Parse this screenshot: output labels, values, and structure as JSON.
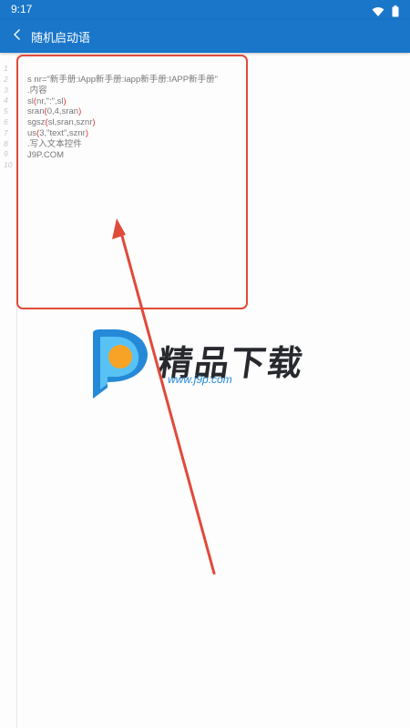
{
  "status_bar": {
    "time": "9:17",
    "icons": [
      "wifi-icon",
      "battery-icon"
    ]
  },
  "app_bar": {
    "title": "随机启动语",
    "back_icon": "chevron-left-icon"
  },
  "editor": {
    "line_numbers": [
      "1",
      "2",
      "3",
      "4",
      "5",
      "6",
      "7",
      "8",
      "9",
      "10"
    ],
    "lines": [
      "s nr=\"新手册:iApp新手册:iapp新手册:IAPP新手册\"",
      ".内容",
      "sl(nr,\":\",sl)",
      "sran(0,4,sran)",
      "sgsz(sl,sran,sznr)",
      "us(3,\"text\",sznr)",
      ".写入文本控件",
      "J9P.COM"
    ]
  },
  "watermark": {
    "brand": "精品下载",
    "url": "www.j9p.com"
  },
  "colors": {
    "primary": "#1976c9",
    "annotation": "#e04a3a",
    "watermark_blue": "#2589d8",
    "watermark_orange": "#f7a325"
  }
}
